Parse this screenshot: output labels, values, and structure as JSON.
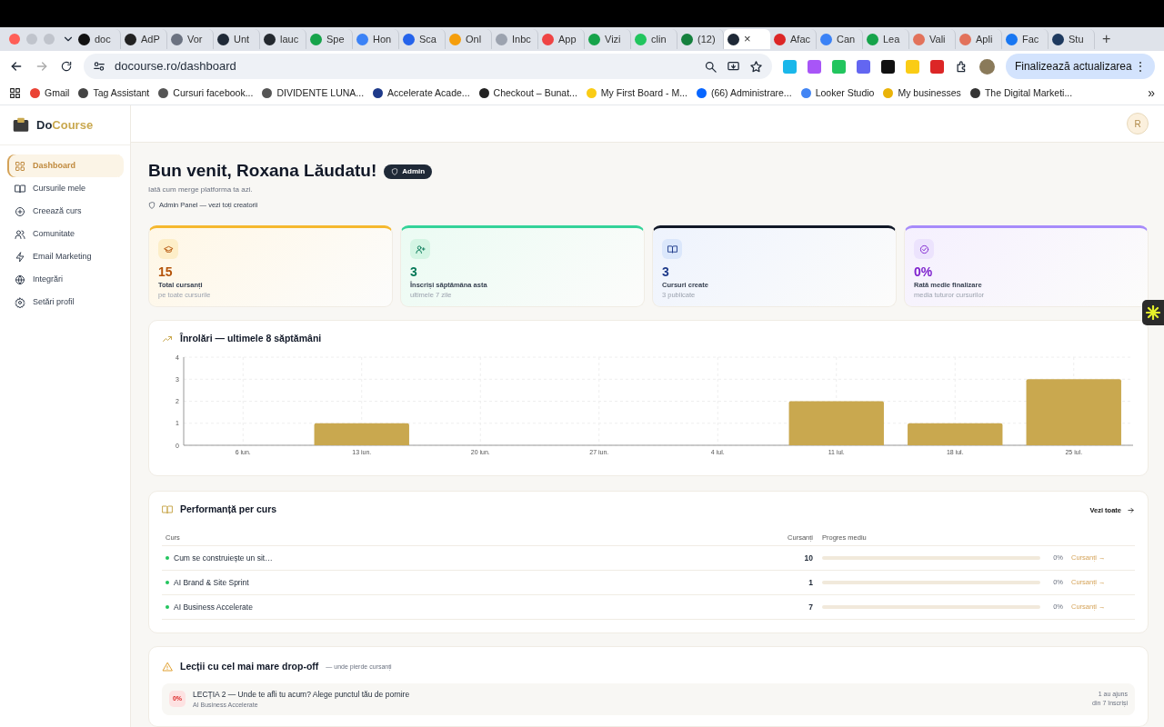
{
  "browser": {
    "tabs": [
      {
        "label": "doc",
        "selected": false,
        "color": "#111111"
      },
      {
        "label": "AdP",
        "selected": false,
        "color": "#222222"
      },
      {
        "label": "Vor",
        "selected": false,
        "color": "#6b7280"
      },
      {
        "label": "Unt",
        "selected": false,
        "color": "#1f2937"
      },
      {
        "label": "lauc",
        "selected": false,
        "color": "#24292f"
      },
      {
        "label": "Spe",
        "selected": false,
        "color": "#16a34a"
      },
      {
        "label": "Hon",
        "selected": false,
        "color": "#3b82f6"
      },
      {
        "label": "Sca",
        "selected": false,
        "color": "#2563eb"
      },
      {
        "label": "Onl",
        "selected": false,
        "color": "#f59e0b"
      },
      {
        "label": "Inbc",
        "selected": false,
        "color": "#9ca3af"
      },
      {
        "label": "App",
        "selected": false,
        "color": "#ef4444"
      },
      {
        "label": "Vizi",
        "selected": false,
        "color": "#16a34a"
      },
      {
        "label": "clin",
        "selected": false,
        "color": "#22c55e"
      },
      {
        "label": "(12)",
        "selected": false,
        "color": "#15803d"
      },
      {
        "selected": true,
        "color": "#1f2937",
        "close": "×"
      },
      {
        "label": "Afac",
        "selected": false,
        "color": "#dc2626"
      },
      {
        "label": "Can",
        "selected": false,
        "color": "#3b82f6"
      },
      {
        "label": "Lea",
        "selected": false,
        "color": "#16a34a"
      },
      {
        "label": "Vali",
        "selected": false,
        "color": "#e2725b"
      },
      {
        "label": "Apli",
        "selected": false,
        "color": "#e2725b"
      },
      {
        "label": "Fac",
        "selected": false,
        "color": "#1877f2"
      },
      {
        "label": "Stu",
        "selected": false,
        "color": "#1e3a5f"
      }
    ],
    "new_tab": "+",
    "url": "docourse.ro/dashboard",
    "extensions": [
      {
        "color": "#1ab7ea"
      },
      {
        "color": "#a855f7"
      },
      {
        "color": "#22c55e"
      },
      {
        "color": "#6366f1"
      },
      {
        "color": "#111111"
      },
      {
        "color": "#facc15"
      },
      {
        "color": "#dc2626"
      }
    ],
    "update_button": "Finalizează actualizarea",
    "menu": "⋮",
    "bookmarks": [
      {
        "label": "Gmail",
        "color": "#ea4335"
      },
      {
        "label": "Tag Assistant",
        "color": "#444444"
      },
      {
        "label": "Cursuri facebook...",
        "color": "#555555"
      },
      {
        "label": "DIVIDENTE LUNA...",
        "color": "#555555"
      },
      {
        "label": "Accelerate Acade...",
        "color": "#1e3a8a"
      },
      {
        "label": "Checkout – Bunat...",
        "color": "#222222"
      },
      {
        "label": "My First Board - M...",
        "color": "#facc15"
      },
      {
        "label": "(66) Administrare...",
        "color": "#0866ff"
      },
      {
        "label": "Looker Studio",
        "color": "#4285f4"
      },
      {
        "label": "My businesses",
        "color": "#eab308"
      },
      {
        "label": "The Digital Marketi...",
        "color": "#333333"
      }
    ],
    "bookmarks_more": "»"
  },
  "app": {
    "logo": {
      "first": "Do",
      "second": "Course"
    },
    "avatar": "R",
    "sidebar": [
      {
        "label": "Dashboard",
        "selected": true
      },
      {
        "label": "Cursurile mele",
        "selected": false
      },
      {
        "label": "Creează curs",
        "selected": false
      },
      {
        "label": "Comunitate",
        "selected": false
      },
      {
        "label": "Email Marketing",
        "selected": false
      },
      {
        "label": "Integrări",
        "selected": false
      },
      {
        "label": "Setări profil",
        "selected": false
      }
    ],
    "greeting": "Bun venit, Roxana Lăudatu!",
    "role_badge": "Admin",
    "subtitle": "Iată cum merge platforma ta azi.",
    "admin_link": "Admin Panel — vezi toți creatorii",
    "stats": [
      {
        "value": "15",
        "label": "Total cursanți",
        "sub": "pe toate cursurile",
        "color": "#f5b82e"
      },
      {
        "value": "3",
        "label": "Înscriși săptămâna asta",
        "sub": "ultimele 7 zile",
        "color": "#34d399"
      },
      {
        "value": "3",
        "label": "Cursuri create",
        "sub": "3 publicate",
        "color": "#111827"
      },
      {
        "value": "0%",
        "label": "Rată medie finalizare",
        "sub": "media tuturor cursurilor",
        "color": "#a78bfa"
      }
    ],
    "chart_card": {
      "title": "Înrolări — ultimele 8 săptămâni",
      "chart_data": {
        "type": "bar",
        "categories": [
          "6 iun.",
          "13 iun.",
          "20 iun.",
          "27 iun.",
          "4 iul.",
          "11 iul.",
          "18 iul.",
          "25 iul."
        ],
        "series": [
          {
            "color": "#c9a84f",
            "values": [
              0,
              1,
              0,
              0,
              0,
              2,
              1,
              3
            ]
          }
        ],
        "ylim": [
          0,
          4
        ],
        "yticks": [
          0,
          1,
          2,
          3,
          4
        ],
        "grid": true
      }
    },
    "performance": {
      "title": "Performanță per curs",
      "see_all": "Vezi toate",
      "columns": [
        "Curs",
        "Cursanți",
        "Progres mediu"
      ],
      "rows": [
        {
          "name": "Cum se construiește un sit…",
          "students": "10",
          "level": 0,
          "percent": "0%",
          "link": "Cursanți →"
        },
        {
          "name": "AI Brand & Site Sprint",
          "students": "1",
          "level": 0,
          "percent": "0%",
          "link": "Cursanți →"
        },
        {
          "name": "AI Business Accelerate",
          "students": "7",
          "level": 0,
          "percent": "0%",
          "link": "Cursanți →"
        }
      ]
    },
    "dropoff": {
      "title": "Lecții cu cel mai mare drop-off",
      "note": "— unde pierde cursanți",
      "items": [
        {
          "badge": "0%",
          "title": "LECȚIA 2 — Unde te afli tu acum? Alege punctul tău de pornire",
          "course": "AI Business Accelerate",
          "reached": "1 au ajuns",
          "of": "din 7 înscriși"
        }
      ]
    }
  }
}
